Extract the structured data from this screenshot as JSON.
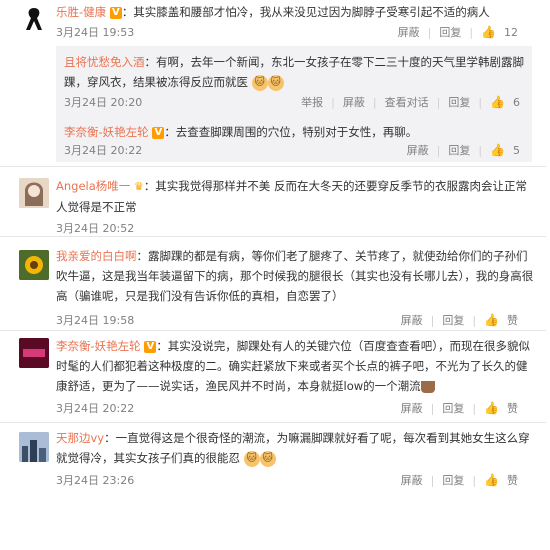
{
  "comments": [
    {
      "user": "乐胜-健康",
      "badge": "V",
      "text": "：其实膝盖和腰部才怕冷，我从来没见过因为脚脖子受寒引起不适的病人",
      "time": "3月24日 19:53",
      "like_count": "12"
    },
    {
      "user": "Angela杨唯一",
      "text": "：其实我觉得那样并不美 反而在大冬天的还要穿反季节的衣服露肉会让正常人觉得是不正常",
      "time": "3月24日 20:52"
    },
    {
      "user": "我亲爱的白白啊",
      "text": "：露脚踝的都是有病，等你们老了腿疼了、关节疼了，就使劲给你们的子孙们吹牛逼，这是我当年装逼留下的病，那个时候我的腿很长（其实也没有长哪儿去），我的身高很高（骗谁呢，只是我们没有告诉你低的真相，自恋罢了）",
      "time": "3月24日 19:58",
      "like_label": "赞"
    },
    {
      "user": "李奈衡-妖艳左轮",
      "badge": "V",
      "text": "：其实没说完，脚踝处有人的关键穴位（百度查查看吧），而现在很多貌似时髦的人们都犯着这种极度的二。确实赶紧放下来或者买个长点的裤子吧，不光为了长久的健康舒适，更为了——说实话，渔民风并不时尚，本身就挺low的一个潮流",
      "time": "3月24日 20:22",
      "like_label": "赞"
    },
    {
      "user": "天那边vy",
      "text": "：一直觉得这是个很奇怪的潮流，为嘛漏脚踝就好看了呢，每次看到其她女生这么穿就觉得冷，其实女孩子们真的很能忍",
      "time": "3月24日 23:26",
      "like_label": "赞"
    }
  ],
  "replies": [
    {
      "user": "且将忧愁免入酒",
      "text": "：有啊，去年一个新闻，东北一女孩子在零下二三十度的天气里学韩剧露脚踝，穿风衣，结果被冻得反应而就医",
      "time": "3月24日 20:20",
      "actions": [
        "举报",
        "屏蔽",
        "查看对话",
        "回复"
      ],
      "like_count": "6"
    },
    {
      "user": "李奈衡-妖艳左轮",
      "badge": "V",
      "text": "：去查查脚踝周围的穴位，特别对于女性，再聊。",
      "time": "3月24日 20:22",
      "like_count": "5"
    }
  ],
  "actions": [
    "屏蔽",
    "回复"
  ]
}
